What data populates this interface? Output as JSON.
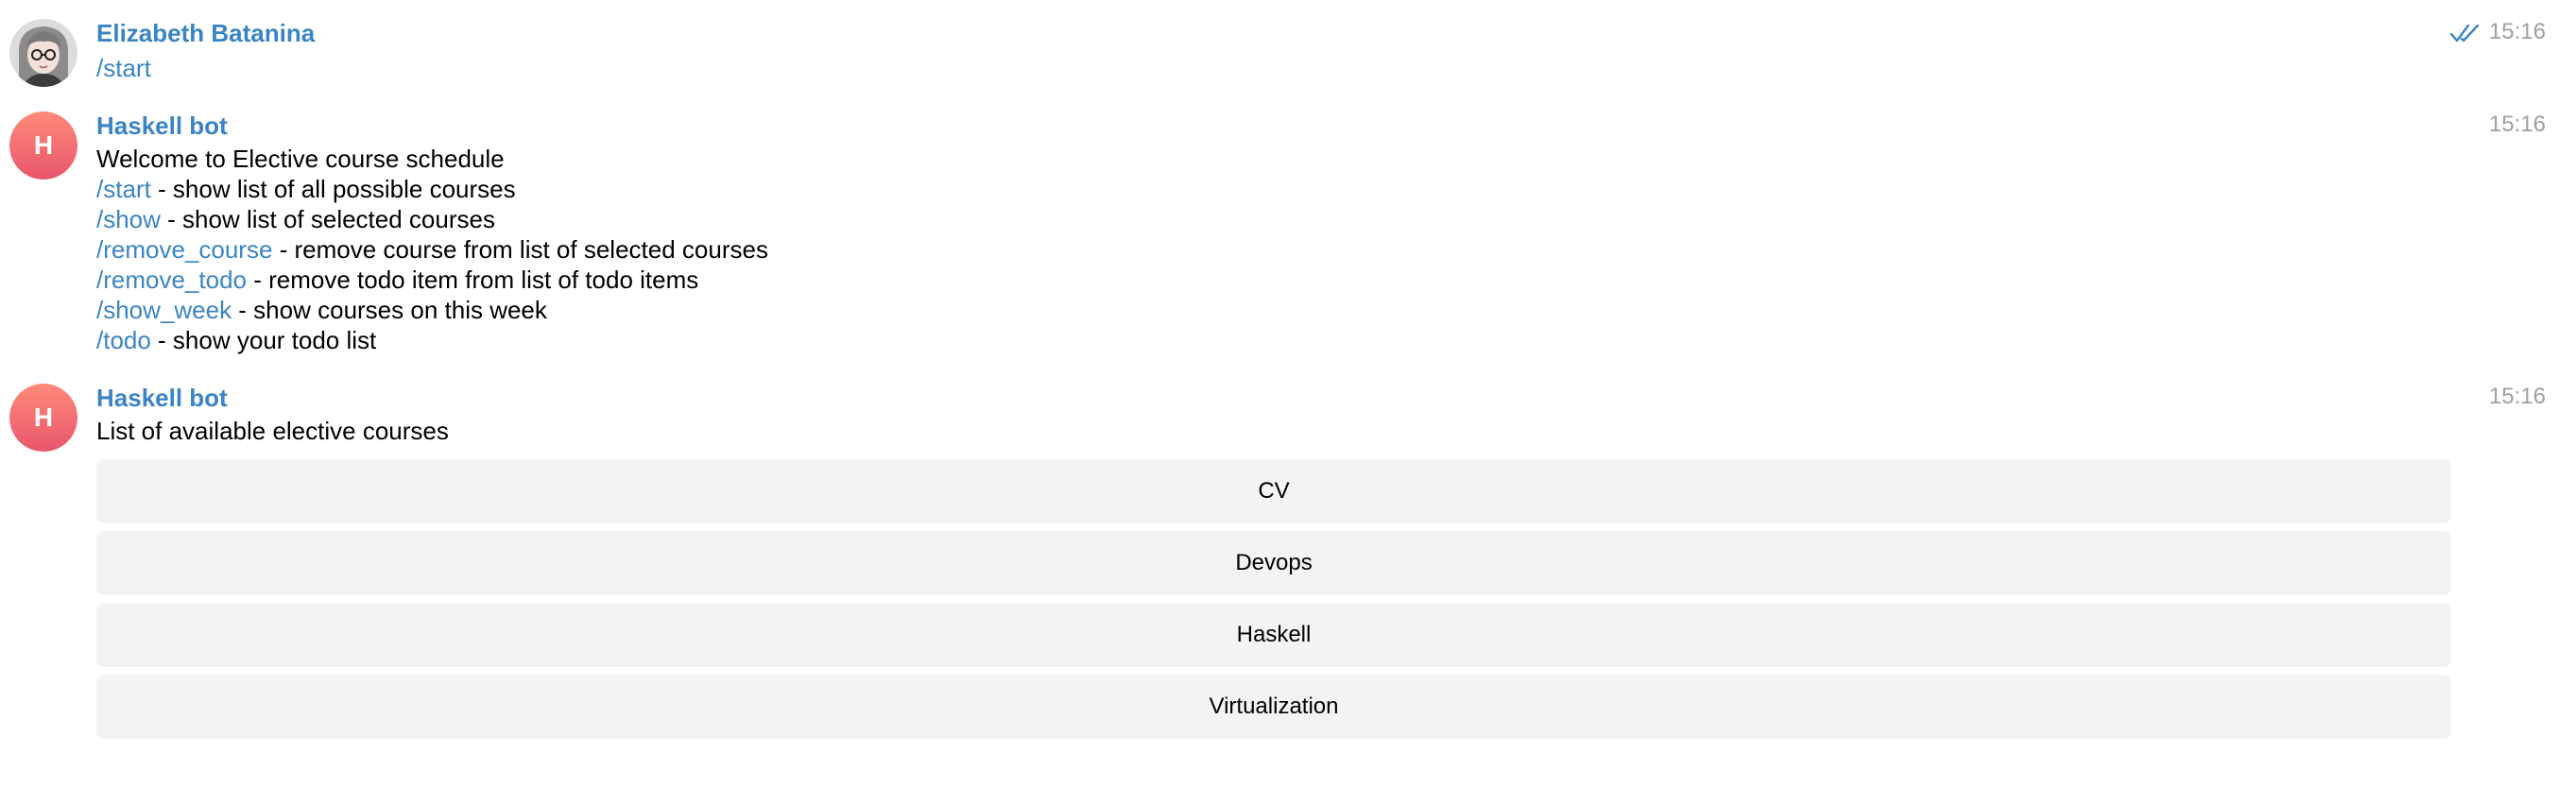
{
  "messages": [
    {
      "sender": "Elizabeth Batanina",
      "time": "15:16",
      "read_status_icon": "double-check-icon",
      "text": "/start"
    },
    {
      "sender": "Haskell bot",
      "avatar_letter": "H",
      "time": "15:16",
      "intro": "Welcome to Elective course schedule",
      "commands": [
        {
          "command": "/start",
          "description": " - show list of all possible courses"
        },
        {
          "command": "/show",
          "description": " - show list of selected courses"
        },
        {
          "command": "/remove_course",
          "description": " - remove course from list of selected courses"
        },
        {
          "command": "/remove_todo",
          "description": " - remove todo item from list of todo items"
        },
        {
          "command": "/show_week",
          "description": " - show courses on this week"
        },
        {
          "command": "/todo",
          "description": " - show your todo list"
        }
      ]
    },
    {
      "sender": "Haskell bot",
      "avatar_letter": "H",
      "time": "15:16",
      "text": "List of available elective courses",
      "keyboard": [
        "CV",
        "Devops",
        "Haskell",
        "Virtualization"
      ]
    }
  ],
  "colors": {
    "link": "#3a84c6",
    "bot_avatar": "#ef6b73",
    "keyboard_button": "#f3f3f3",
    "timestamp": "#9aa0a6"
  }
}
